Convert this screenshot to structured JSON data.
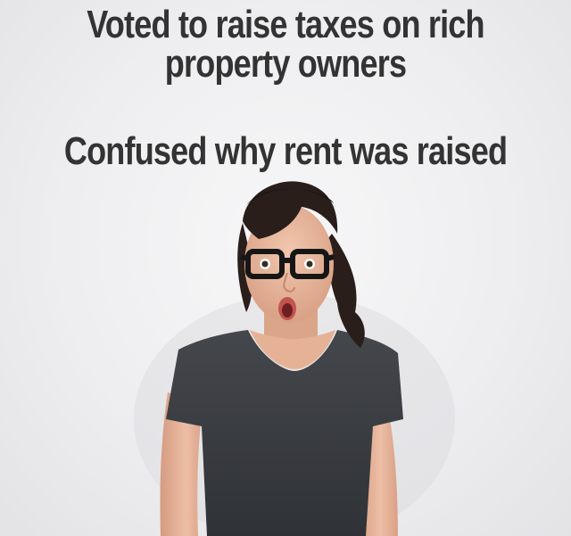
{
  "meme": {
    "caption_top_line1": "Voted to raise taxes on rich",
    "caption_top_line2": "property owners",
    "caption_bottom": "Confused why rent was raised"
  },
  "colors": {
    "caption_text": "#333333",
    "background": "#efeff1",
    "shirt": "#3a3d42",
    "hair": "#2a1e1a",
    "skin": "#e9b9a0"
  },
  "photo": {
    "subject": "shocked woman with glasses and dark t-shirt"
  }
}
